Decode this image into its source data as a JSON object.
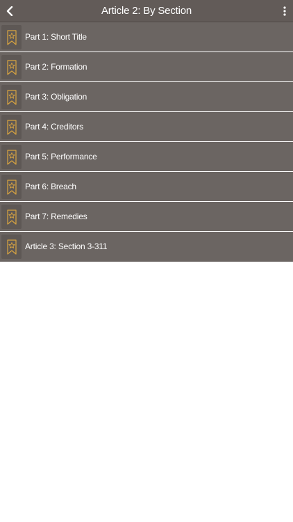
{
  "header": {
    "title": "Article 2: By Section",
    "back_icon": "chevron-left-icon",
    "menu_icon": "more-vertical-icon"
  },
  "colors": {
    "header_bg": "#625b58",
    "row_bg": "#6b6562",
    "bookmark_accent": "#d9a441"
  },
  "items": [
    {
      "label": "Part 1: Short Title",
      "icon": "bookmark-star-icon"
    },
    {
      "label": "Part 2: Formation",
      "icon": "bookmark-star-icon"
    },
    {
      "label": "Part 3: Obligation",
      "icon": "bookmark-star-icon"
    },
    {
      "label": "Part 4: Creditors",
      "icon": "bookmark-star-icon"
    },
    {
      "label": "Part 5: Performance",
      "icon": "bookmark-star-icon"
    },
    {
      "label": "Part 6: Breach",
      "icon": "bookmark-star-icon"
    },
    {
      "label": "Part 7: Remedies",
      "icon": "bookmark-star-icon"
    },
    {
      "label": "Article 3: Section 3-311",
      "icon": "bookmark-star-icon"
    }
  ]
}
